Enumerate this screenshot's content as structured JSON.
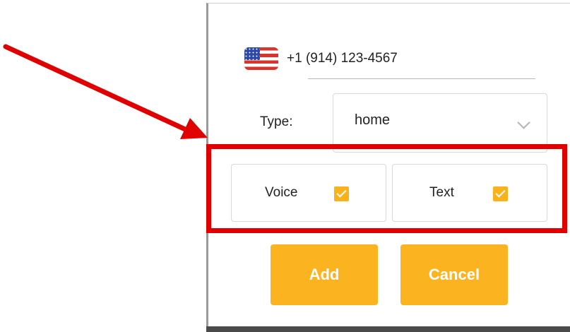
{
  "phone": {
    "country_flag_icon": "us-flag-icon",
    "number": "+1 (914) 123-4567"
  },
  "type_field": {
    "label": "Type:",
    "selected": "home",
    "dropdown_icon": "chevron-down-icon"
  },
  "options": {
    "voice": {
      "label": "Voice",
      "checked": true
    },
    "text": {
      "label": "Text",
      "checked": true
    }
  },
  "buttons": {
    "add": "Add",
    "cancel": "Cancel"
  },
  "annotation": {
    "highlight_color": "#e00000",
    "arrow_icon": "red-arrow-icon"
  },
  "colors": {
    "accent": "#fbb41f",
    "checkbox": "#f9b21a"
  }
}
